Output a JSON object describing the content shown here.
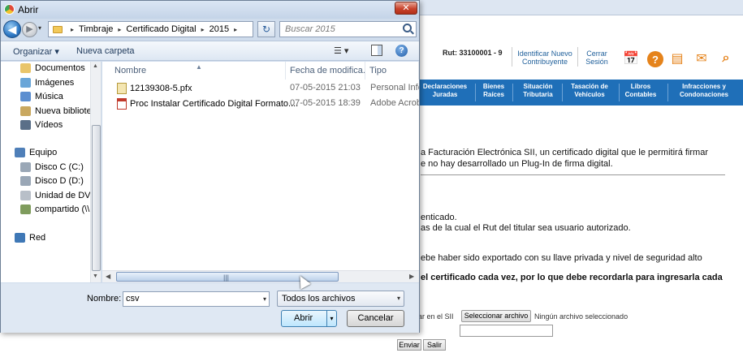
{
  "dialog": {
    "title": "Abrir",
    "close_glyph": "✕",
    "back_glyph": "◀",
    "forward_glyph": "▶",
    "history_glyph": "▾",
    "breadcrumb": [
      "Timbraje",
      "Certificado Digital",
      "2015"
    ],
    "breadcrumb_sep": "▸",
    "breadcrumb_drop": "▾",
    "refresh_glyph": "↻",
    "search_placeholder": "Buscar 2015",
    "toolbar": {
      "organize": "Organizar ▾",
      "new_folder": "Nueva carpeta",
      "views_glyph": "☰ ▾",
      "help_glyph": "?"
    },
    "nav_pane": {
      "up_arrow": "▲",
      "down_arrow": "▼",
      "items": [
        {
          "label": "Documentos",
          "color": "#e9c56a"
        },
        {
          "label": "Imágenes",
          "color": "#6aa6d8"
        },
        {
          "label": "Música",
          "color": "#5c8ed0"
        },
        {
          "label": "Nueva bibliotec",
          "color": "#c9a860"
        },
        {
          "label": "Vídeos",
          "color": "#5a6f88"
        },
        {
          "label": "Equipo",
          "color": "#4f7fb8"
        },
        {
          "label": "Disco C (C:)",
          "color": "#9aa7b6"
        },
        {
          "label": "Disco D (D:)",
          "color": "#9aa7b6"
        },
        {
          "label": "Unidad de DVD",
          "color": "#b8bfc8"
        },
        {
          "label": "compartido (\\\\",
          "color": "#7f9c5d"
        },
        {
          "label": "Red",
          "color": "#3f78b6"
        }
      ]
    },
    "columns": {
      "name": "Nombre",
      "date": "Fecha de modifica...",
      "type": "Tipo",
      "sort_glyph": "▲"
    },
    "files": [
      {
        "name": "12139308-5.pfx",
        "date": "07-05-2015 21:03",
        "type": "Personal Info",
        "icon": "certificate-file-icon"
      },
      {
        "name": "Proc Instalar Certificado Digital Formato....",
        "date": "07-05-2015 18:39",
        "type": "Adobe Acrob",
        "icon": "pdf-file-icon"
      }
    ],
    "scroll": {
      "left_arrow": "◀",
      "right_arrow": "▶",
      "grip": "|||"
    },
    "filename_label": "Nombre:",
    "filename_value": "csv",
    "filename_drop": "▾",
    "filetype_value": "Todos los archivos",
    "filetype_drop": "▾",
    "open_label": "Abrir",
    "open_split": "▾",
    "cancel_label": "Cancelar"
  },
  "page": {
    "rut": "Rut: 33100001 - 9",
    "identify_link": [
      "Identificar Nuevo",
      "Contribuyente"
    ],
    "logout_link": [
      "Cerrar",
      "Sesión"
    ],
    "header_icons": {
      "calendar": "📅",
      "help": "?",
      "docs": "▤",
      "mail": "✉",
      "search": "⌕"
    },
    "nav": [
      [
        "Declaraciones",
        "Juradas"
      ],
      [
        "Bienes",
        "Raíces"
      ],
      [
        "Situación",
        "Tributaria"
      ],
      [
        "Tasación de",
        "Vehículos"
      ],
      [
        "Libros",
        "Contables"
      ],
      [
        "Infracciones y",
        "Condonaciones"
      ]
    ],
    "text1": "a Facturación Electrónica SII, un certificado digital que le permitirá firmar",
    "text2": "e no hay desarrollado un Plug-In de firma digital.",
    "text3": "enticado.",
    "text4": "as de la cual el Rut del titular sea usuario autorizado.",
    "text5": "ebe haber sido exportado con su llave privada y nivel de seguridad alto",
    "text6": "el certificado cada vez, por lo que debe recordarla para ingresarla cada",
    "file_label": "har en el SII",
    "file_button": "Seleccionar archivo",
    "file_none": "Ningún archivo seleccionado",
    "send_button": "Enviar",
    "exit_button": "Salir"
  }
}
